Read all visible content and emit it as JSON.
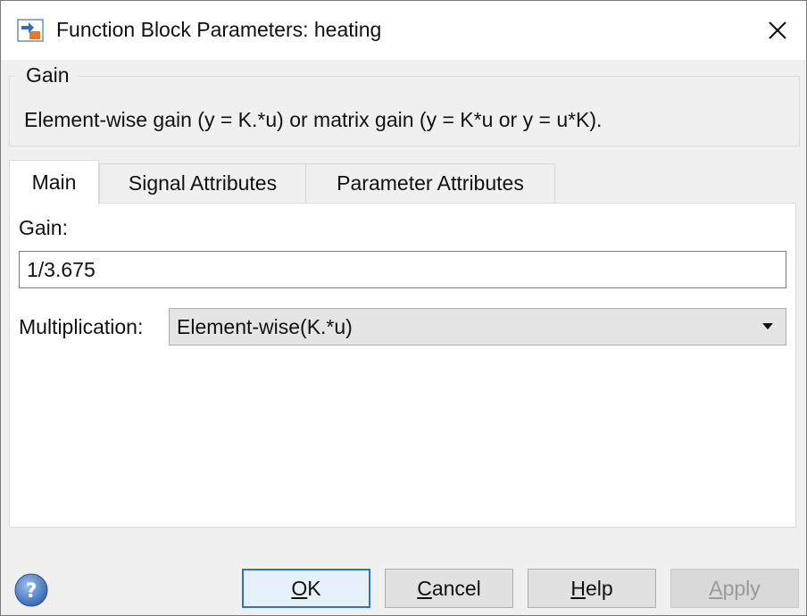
{
  "window": {
    "title": "Function Block Parameters: heating",
    "icon": "simulink-block-icon",
    "close_icon": "close-icon"
  },
  "group": {
    "title": "Gain",
    "description": "Element-wise gain (y = K.*u) or matrix gain (y = K*u or y = u*K)."
  },
  "tabs": [
    {
      "label": "Main",
      "active": true
    },
    {
      "label": "Signal Attributes",
      "active": false
    },
    {
      "label": "Parameter Attributes",
      "active": false
    }
  ],
  "main": {
    "gain_label": "Gain:",
    "gain_value": "1/3.675",
    "multiplication_label": "Multiplication:",
    "multiplication_value": "Element-wise(K.*u)"
  },
  "buttons": {
    "ok": {
      "mnemonic": "O",
      "rest": "K"
    },
    "cancel": {
      "mnemonic": "C",
      "rest": "ancel"
    },
    "help": {
      "mnemonic": "H",
      "rest": "elp"
    },
    "apply": {
      "mnemonic": "A",
      "rest": "pply"
    }
  },
  "colors": {
    "accent": "#2f73c9",
    "help_icon": "#4a78c2"
  }
}
